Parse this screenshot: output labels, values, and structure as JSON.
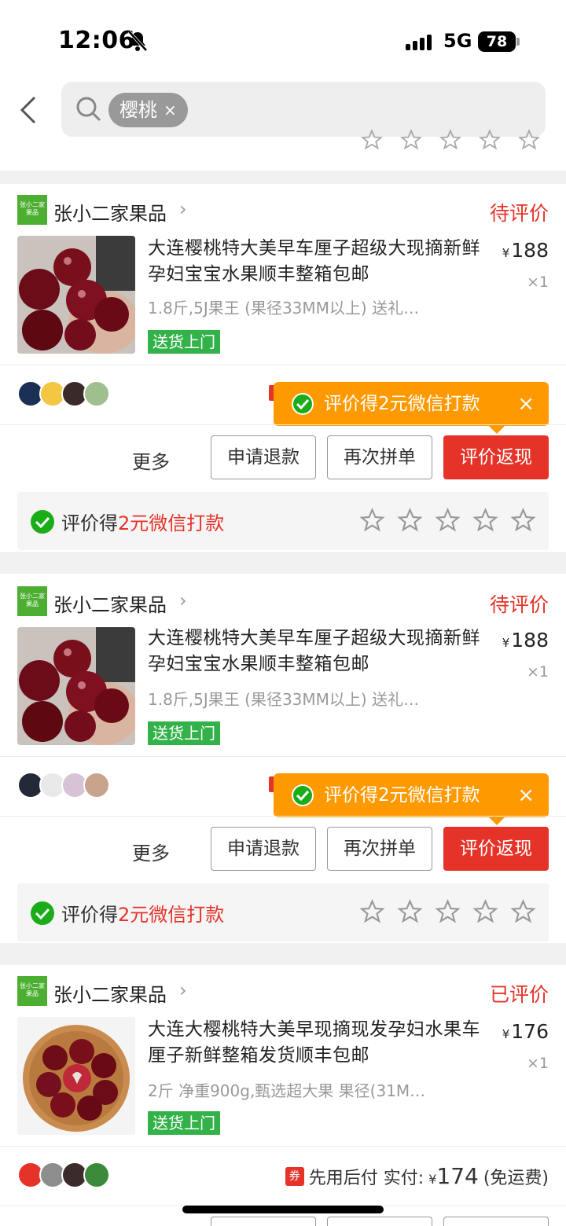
{
  "status_bar": {
    "time": "12:06",
    "network": "5G",
    "battery": "78"
  },
  "header": {
    "search_chip": "樱桃",
    "chip_close": "×"
  },
  "orders": [
    {
      "shop_name": "张小二家果品",
      "shop_logo_text": "张小二家果品",
      "status": "待评价",
      "title": "大连樱桃特大美早车厘子超级大现摘新鲜孕妇宝宝水果顺丰整箱包邮",
      "spec": "1.8斤,5J果王 (果径33MM以上) 送礼…",
      "tag": "送货上门",
      "currency": "¥",
      "price": "188",
      "qty": "×1",
      "promo": "评价得2元微信打款",
      "promo_close": "×",
      "more": "更多",
      "buttons": [
        "申请退款",
        "再次拼单",
        "评价返现"
      ],
      "review_prefix": "评价得",
      "review_amount": "2元微信打款"
    },
    {
      "shop_name": "张小二家果品",
      "shop_logo_text": "张小二家果品",
      "status": "待评价",
      "title": "大连樱桃特大美早车厘子超级大现摘新鲜孕妇宝宝水果顺丰整箱包邮",
      "spec": "1.8斤,5J果王 (果径33MM以上) 送礼…",
      "tag": "送货上门",
      "currency": "¥",
      "price": "188",
      "qty": "×1",
      "promo": "评价得2元微信打款",
      "promo_close": "×",
      "more": "更多",
      "buttons": [
        "申请退款",
        "再次拼单",
        "评价返现"
      ],
      "review_prefix": "评价得",
      "review_amount": "2元微信打款"
    },
    {
      "shop_name": "张小二家果品",
      "shop_logo_text": "张小二家果品",
      "status": "已评价",
      "title": "大连大樱桃特大美早现摘现发孕妇水果车厘子新鲜整箱发货顺丰包邮",
      "spec": "2斤 净重900g,甄选超大果 果径(31M…",
      "tag": "送货上门",
      "currency": "¥",
      "price": "176",
      "qty": "×1",
      "coupon": "券",
      "pay_label": "先用后付 实付:",
      "pay_currency": "¥",
      "pay_amount": "174",
      "pay_note": "(免运费)"
    }
  ],
  "colors": {
    "accent_red": "#e53329",
    "promo_orange": "#ff9900",
    "tag_green": "#33b24a",
    "wechat_green": "#1aad19"
  },
  "icons": [
    "bell-slash-icon",
    "signal-icon",
    "back-icon",
    "search-icon",
    "wechat-check-icon",
    "star-icon",
    "chevron-right-icon",
    "coupon-icon"
  ]
}
